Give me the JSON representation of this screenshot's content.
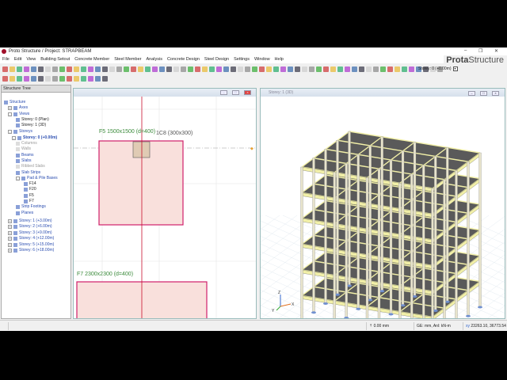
{
  "window": {
    "title": "Proto Structure / Project: STRAPBEAM",
    "min": "–",
    "restore": "❐",
    "close": "✕"
  },
  "brand": {
    "bold": "Prota",
    "rest": "Structure"
  },
  "menu": [
    "File",
    "Edit",
    "View",
    "Building Setout",
    "Concrete Member",
    "Steel Member",
    "Analysis",
    "Concrete Design",
    "Steel Design",
    "Settings",
    "Window",
    "Help"
  ],
  "toolbar": {
    "storey_label": "Storey: 0 (+0.00m)",
    "dropdown": "▾"
  },
  "tree": {
    "title": "Structure Tree",
    "items": [
      {
        "label": "Structure",
        "level": 0,
        "cls": "blue"
      },
      {
        "label": "Axes",
        "level": 1,
        "cls": "blue",
        "exp": "+"
      },
      {
        "label": "Views",
        "level": 1,
        "cls": "blue",
        "exp": "-"
      },
      {
        "label": "Storey: 0 (Plan)",
        "level": 3,
        "cls": ""
      },
      {
        "label": "Storey: 1 (3D)",
        "level": 3,
        "cls": ""
      },
      {
        "label": "Storeys",
        "level": 1,
        "cls": "blue",
        "exp": "-"
      },
      {
        "label": "Storey: 0 (+0.00m)",
        "level": 2,
        "cls": "blue bold",
        "exp": "-"
      },
      {
        "label": "Columns",
        "level": 3,
        "cls": "grey"
      },
      {
        "label": "Walls",
        "level": 3,
        "cls": "grey"
      },
      {
        "label": "Beams",
        "level": 3,
        "cls": "blue"
      },
      {
        "label": "Slabs",
        "level": 3,
        "cls": "blue"
      },
      {
        "label": "Ribbed Slabs",
        "level": 3,
        "cls": "grey"
      },
      {
        "label": "Slab Strips",
        "level": 3,
        "cls": "blue"
      },
      {
        "label": "Pad & Pile Bases",
        "level": 3,
        "cls": "blue",
        "exp": "-"
      },
      {
        "label": "F14",
        "level": 5,
        "cls": ""
      },
      {
        "label": "F20",
        "level": 5,
        "cls": ""
      },
      {
        "label": "F5",
        "level": 5,
        "cls": ""
      },
      {
        "label": "F7",
        "level": 5,
        "cls": ""
      },
      {
        "label": "Strip Footings",
        "level": 3,
        "cls": "blue"
      },
      {
        "label": "Planes",
        "level": 3,
        "cls": "blue"
      },
      {
        "label": "Storey: 1 (+3.00m)",
        "level": 1,
        "cls": "blue",
        "exp": "+"
      },
      {
        "label": "Storey: 2 (+6.00m)",
        "level": 1,
        "cls": "blue",
        "exp": "+"
      },
      {
        "label": "Storey: 3 (+9.00m)",
        "level": 1,
        "cls": "blue",
        "exp": "+"
      },
      {
        "label": "Storey: 4 (+12.00m)",
        "level": 1,
        "cls": "blue",
        "exp": "+"
      },
      {
        "label": "Storey: 5 (+15.00m)",
        "level": 1,
        "cls": "blue",
        "exp": "+"
      },
      {
        "label": "Storey: 6 (+18.00m)",
        "level": 1,
        "cls": "blue",
        "exp": "+"
      }
    ]
  },
  "plan": {
    "f5_label": "F5   1500x1500 (d=400)",
    "column_label": "1C8 (300x300)",
    "f7_label": "F7   2300x2300 (d=400)"
  },
  "view3d": {
    "title": "Storey: 1 (3D)",
    "axis_z": "Z",
    "axis_x": "X",
    "axis_y": "Y"
  },
  "status": {
    "elevation": "0.00 mm",
    "units": "GE: mm, Anl: kN-m",
    "coords": "23263.10, 36773.54"
  },
  "colors": {
    "slab": "#5a5a5a",
    "beam": "#f2f0a8",
    "column": "#e8e4cc",
    "footing": "#f9e0dc",
    "footing_border": "#d0206a",
    "axis": "#c8102e"
  }
}
